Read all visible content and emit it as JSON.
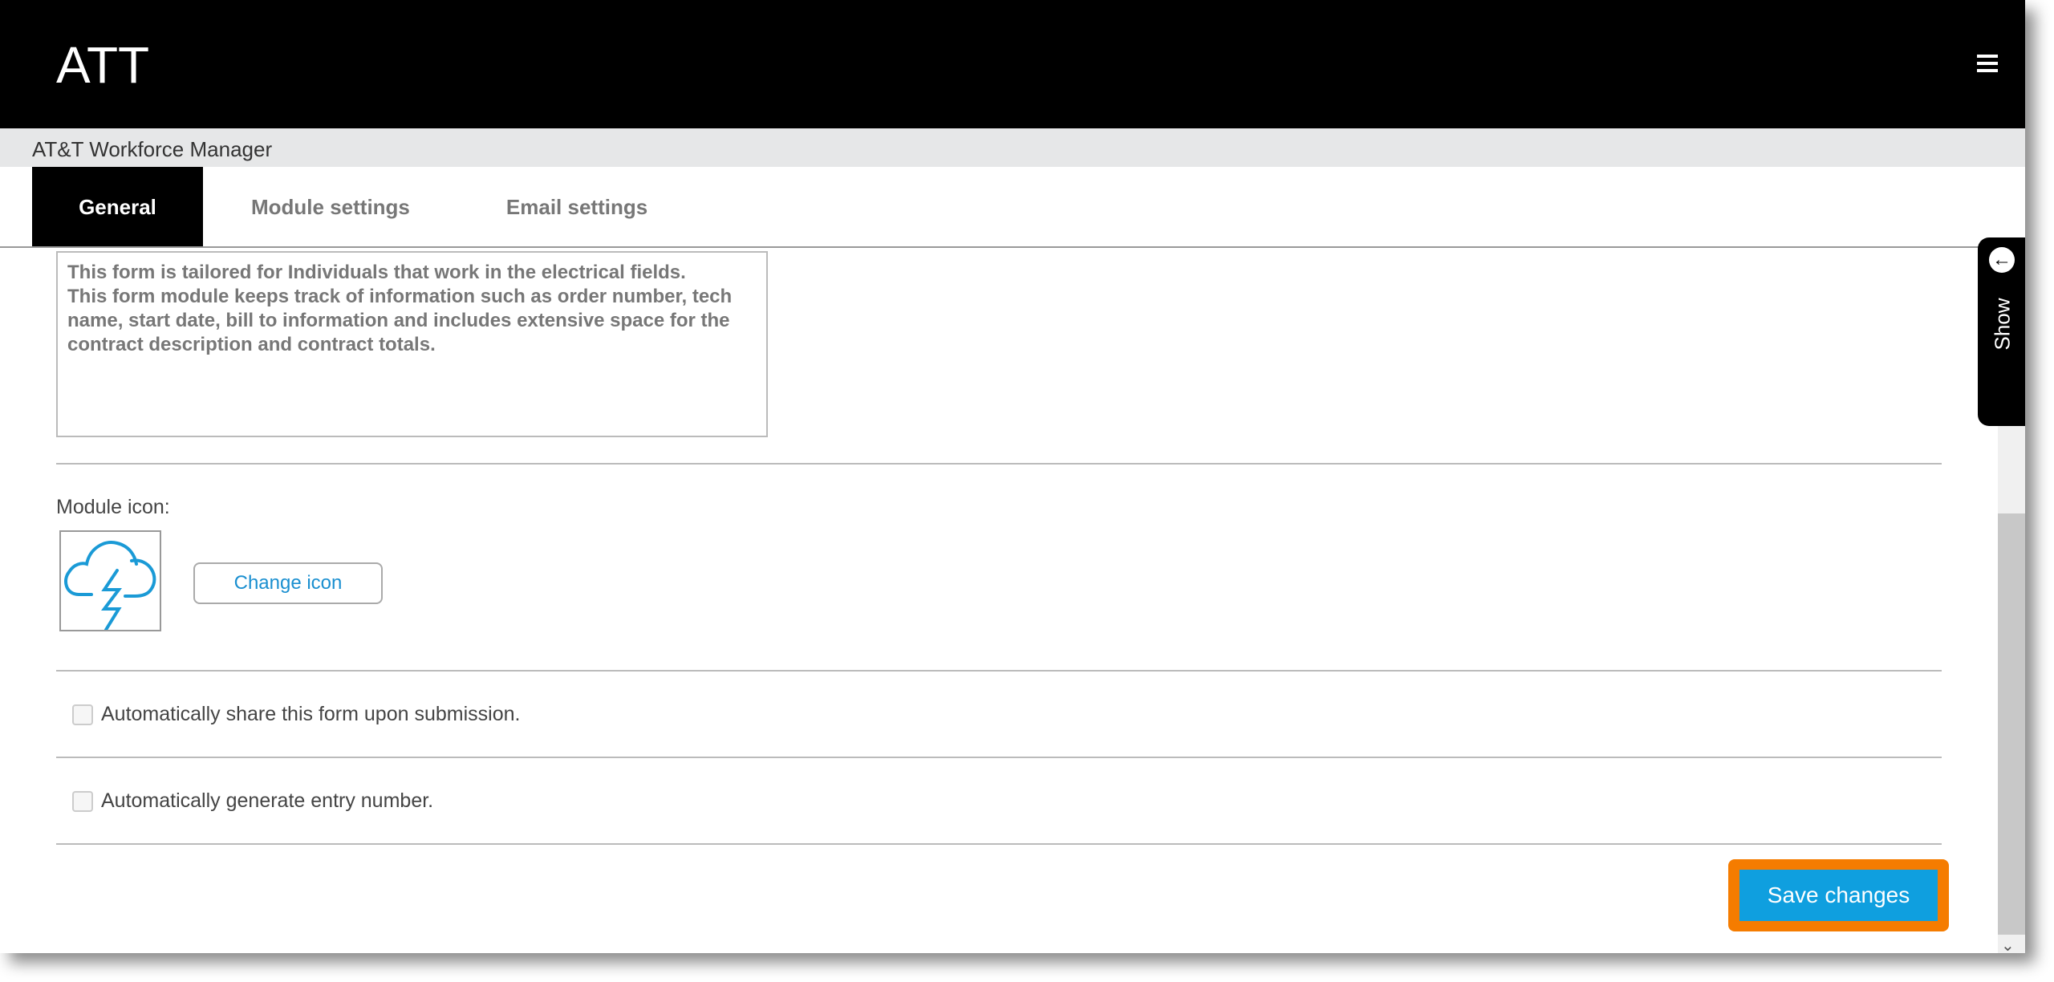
{
  "header": {
    "logo": "ATT",
    "menu_icon": "hamburger-icon"
  },
  "app_title": "AT&T Workforce Manager",
  "tabs": [
    {
      "label": "General",
      "active": true
    },
    {
      "label": "Module settings"
    },
    {
      "label": "Email settings"
    }
  ],
  "description": "This form is tailored for Individuals that work in the electrical fields.\nThis form module keeps track of information such as order number, tech name, start date, bill to information and includes extensive space for the contract description and contract totals.",
  "module_icon": {
    "label": "Module icon:",
    "icon": "cloud-lightning-icon",
    "icon_color": "#1a9ad6",
    "change_label": "Change icon"
  },
  "options": [
    {
      "label": "Automatically share this form upon submission.",
      "checked": false
    },
    {
      "label": "Automatically generate entry number.",
      "checked": false
    }
  ],
  "save_label": "Save changes",
  "side_panel": {
    "label": "Show",
    "icon": "arrow-left-circle-icon"
  },
  "colors": {
    "save_button": "#0f9fdf",
    "highlight": "#f57c00"
  }
}
